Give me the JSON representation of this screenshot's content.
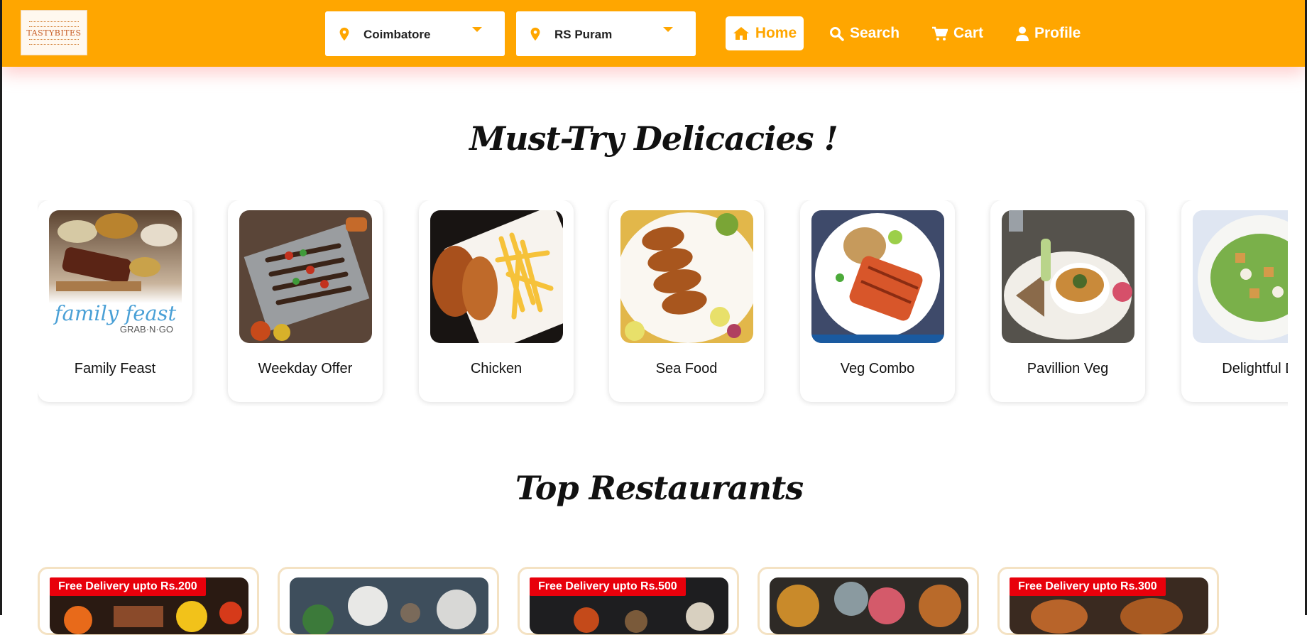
{
  "brand": {
    "logo_text": "TASTYBITES"
  },
  "location": {
    "city": "Coimbatore",
    "area": "RS Puram"
  },
  "nav": {
    "home": "Home",
    "search": "Search",
    "cart": "Cart",
    "profile": "Profile"
  },
  "sections": {
    "delicacies_title": "Must-Try Delicacies !",
    "restaurants_title": "Top Restaurants"
  },
  "dishes": [
    {
      "name": "Family Feast",
      "image": "family-feast-photo",
      "overlay_text": "family feast",
      "overlay_sub": "GRAB·N·GO"
    },
    {
      "name": "Weekday Offer",
      "image": "skewers-grill-photo"
    },
    {
      "name": "Chicken",
      "image": "fried-chicken-fries-photo"
    },
    {
      "name": "Sea Food",
      "image": "grilled-prawns-photo"
    },
    {
      "name": "Veg Combo",
      "image": "rice-grilled-paneer-photo"
    },
    {
      "name": "Pavillion Veg",
      "image": "hummus-bowl-photo"
    },
    {
      "name": "Delightful D",
      "image": "caesar-salad-photo"
    }
  ],
  "restaurants": [
    {
      "badge": "Free Delivery upto Rs.200",
      "image": "bbq-skewers-photo"
    },
    {
      "badge": "",
      "image": "spices-bowls-photo"
    },
    {
      "badge": "Free Delivery upto Rs.500",
      "image": "dark-table-dishes-photo"
    },
    {
      "badge": "",
      "image": "curry-bowls-photo"
    },
    {
      "badge": "Free Delivery upto Rs.300",
      "image": "roast-chicken-photo"
    }
  ],
  "colors": {
    "header_bg": "#ffa600",
    "badge_bg": "#e8000b",
    "card_border": "#f4e2c3"
  }
}
